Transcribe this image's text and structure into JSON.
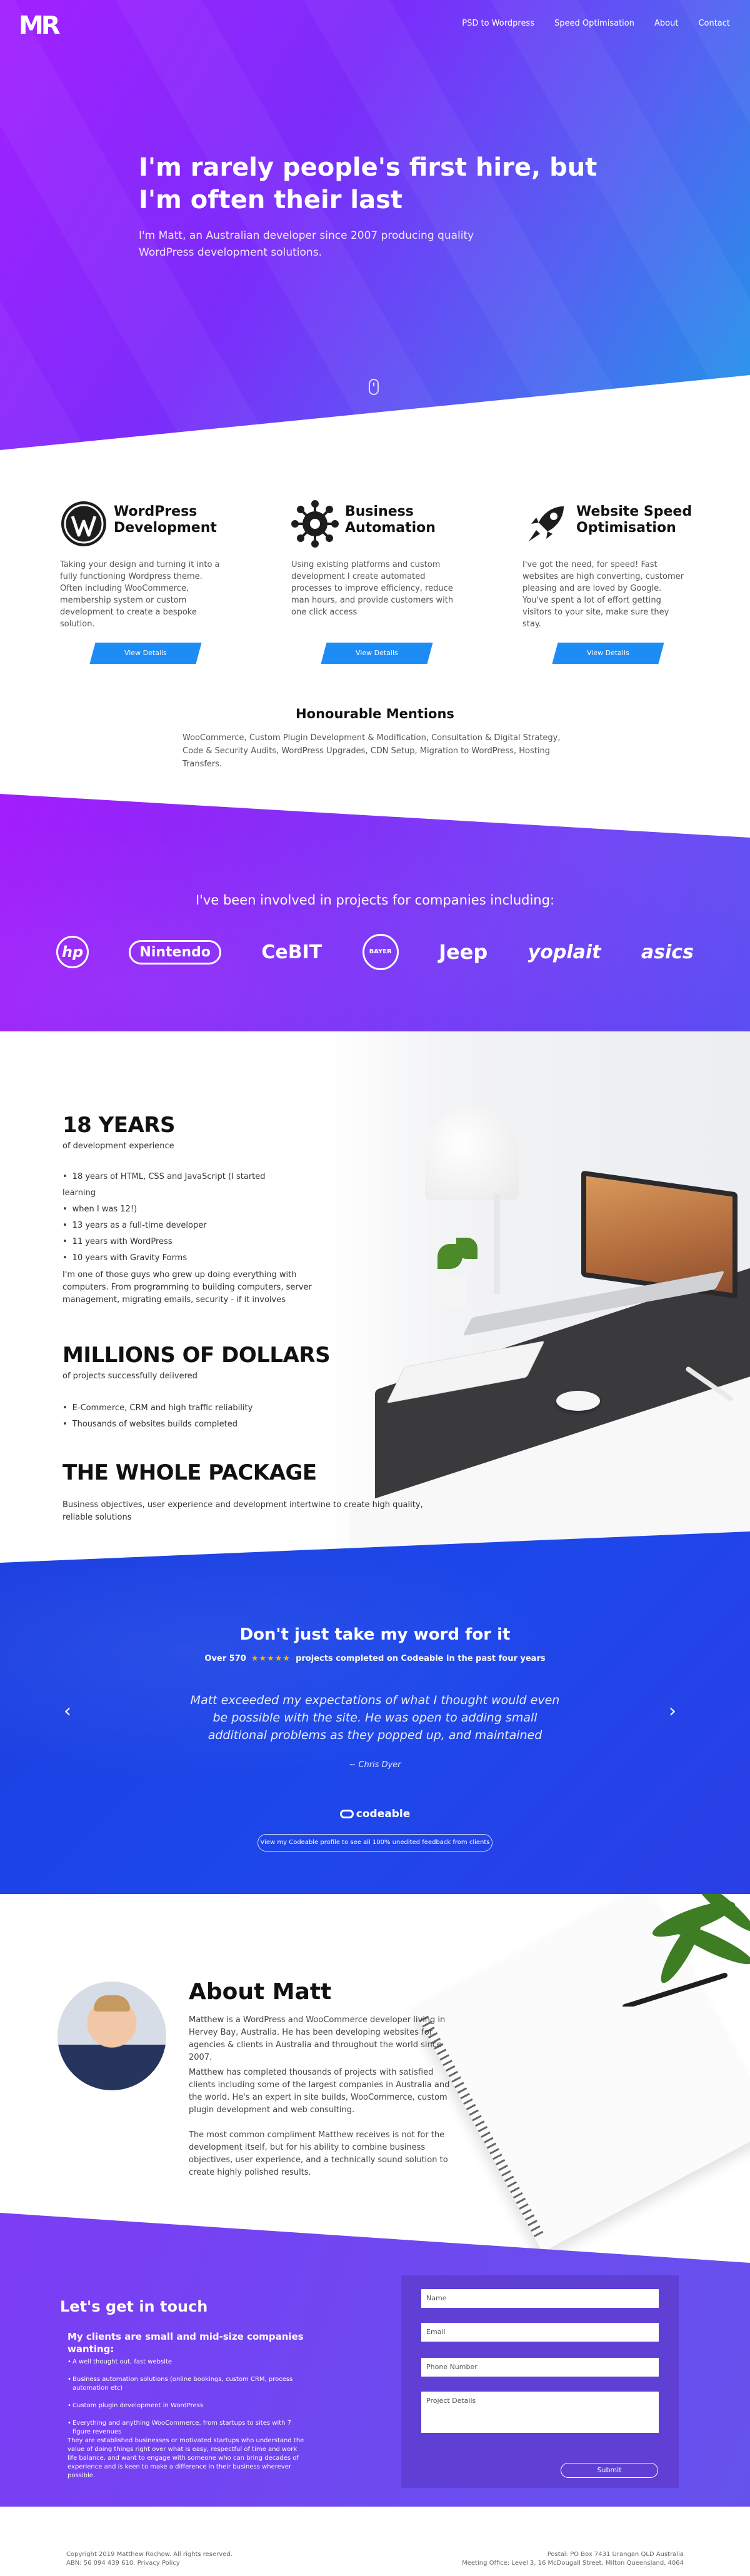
{
  "brand": {
    "logo_text": "MR"
  },
  "nav": [
    "PSD to Wordpress",
    "Speed Optimisation",
    "About",
    "Contact"
  ],
  "hero": {
    "title": "I'm rarely people's first hire, but I'm often their last",
    "subtitle": "I'm Matt, an Australian developer since 2007 producing quality WordPress development solutions."
  },
  "services": [
    {
      "icon": "wordpress-icon",
      "title": "WordPress Development",
      "desc": "Taking your design and turning it into a fully functioning Wordpress theme. Often including WooCommerce, membership system or custom development to create a bespoke solution.",
      "button": "View Details"
    },
    {
      "icon": "gear-network-icon",
      "title": "Business Automation",
      "desc": "Using existing platforms and custom development I create automated processes to improve efficiency, reduce man hours, and provide customers with one click access",
      "button": "View Details"
    },
    {
      "icon": "rocket-icon",
      "title": "Website Speed Optimisation",
      "desc": "I've got the need, for speed! Fast websites are high converting, customer pleasing and are loved by Google. You've spent a lot of effort getting visitors to your site, make sure they stay.",
      "button": "View Details"
    }
  ],
  "mentions": {
    "title": "Honourable Mentions",
    "text": "WooCommerce, Custom Plugin Development & Modification, Consultation & Digital Strategy, Code & Security Audits, WordPress Upgrades, CDN Setup, Migration to WordPress, Hosting Transfers."
  },
  "clients": {
    "title": "I've been involved in projects for companies including:",
    "logos": [
      "hp",
      "Nintendo",
      "CeBIT",
      "BAYER",
      "Jeep",
      "yoplait",
      "asics"
    ]
  },
  "experience": {
    "h1": "18 YEARS",
    "h1_sub": "of development experience",
    "list1": [
      "18 years of HTML, CSS and JavaScript (I started learning",
      "when I was 12!)",
      "13 years as a full-time developer",
      "11 years with WordPress",
      "10 years with Gravity Forms"
    ],
    "para": "I'm one of those guys who grew up doing everything with computers. From programming to building computers, server management, migrating emails, security - if it involves",
    "h2": "MILLIONS OF DOLLARS",
    "h2_sub": "of projects successfully delivered",
    "list2": [
      "E-Commerce, CRM and high traffic reliability",
      "Thousands of websites builds completed"
    ],
    "h3": "THE WHOLE PACKAGE",
    "h3_text": "Business objectives, user experience and development intertwine to create high quality, reliable solutions"
  },
  "testimonial": {
    "title": "Don't just take my word for it",
    "count_left": "Over 570",
    "stars": "★★★★★",
    "count_right": "projects completed on Codeable in the past four years",
    "quote": "Matt exceeded my expectations of what I thought would even be possible with the site. He was open to adding small additional problems as they popped up, and maintained",
    "author": "~ Chris Dyer",
    "platform": "codeable",
    "button": "View my Codeable profile to see all 100% unedited feedback from clients"
  },
  "about": {
    "title": "About Matt",
    "p1": "Matthew is a WordPress and WooCommerce developer living in Hervey Bay, Australia. He has been developing websites for agencies & clients in Australia and throughout the world since 2007.",
    "p2": "Matthew has completed thousands of projects with satisfied clients including some of the largest companies in Australia and the world. He's an expert in site builds, WooCommerce, custom plugin development and web consulting.",
    "p3": "The most common compliment Matthew receives is not for the development itself, but for his ability to combine business objectives, user experience, and a technically sound solution to create highly polished results."
  },
  "contact": {
    "title": "Let's get in touch",
    "sub": "My clients are small and mid-size companies wanting:",
    "list": [
      "A well thought out, fast website",
      "Business automation solutions (online bookings, custom CRM, process automation etc)",
      "Custom plugin development in WordPress",
      "Everything and anything WooCommerce, from startups to sites with 7 figure revenues"
    ],
    "para": "They are established businesses or motivated startups who understand the value of doing things right over what is easy, respectful of time and work life balance, and want to engage with someone who can bring decades of experience and is keen to make a difference in their business wherever possible.",
    "form": {
      "name": "Name",
      "email": "Email",
      "phone": "Phone Number",
      "details": "Project Details",
      "submit": "Submit"
    }
  },
  "footer": {
    "left1": "Copyright 2019 Matthew Rochow. All rights reserved.",
    "left2": "ABN: 56 094 439 610. Privacy Policy",
    "right1": "Postal: PO Box 7431 Urangan QLD Australia",
    "right2": "Meeting Office: Level 3, 16 McDougall Street, Milton Queensland, 4064"
  },
  "colors": {
    "hero_start": "#a220ff",
    "hero_end": "#1f98e8",
    "button_blue": "#1d8cf5",
    "testimonial_blue": "#1d47ea",
    "contact_purple": "#7c3cf4",
    "form_bg": "#5f3fd4",
    "star": "#f5b800"
  }
}
